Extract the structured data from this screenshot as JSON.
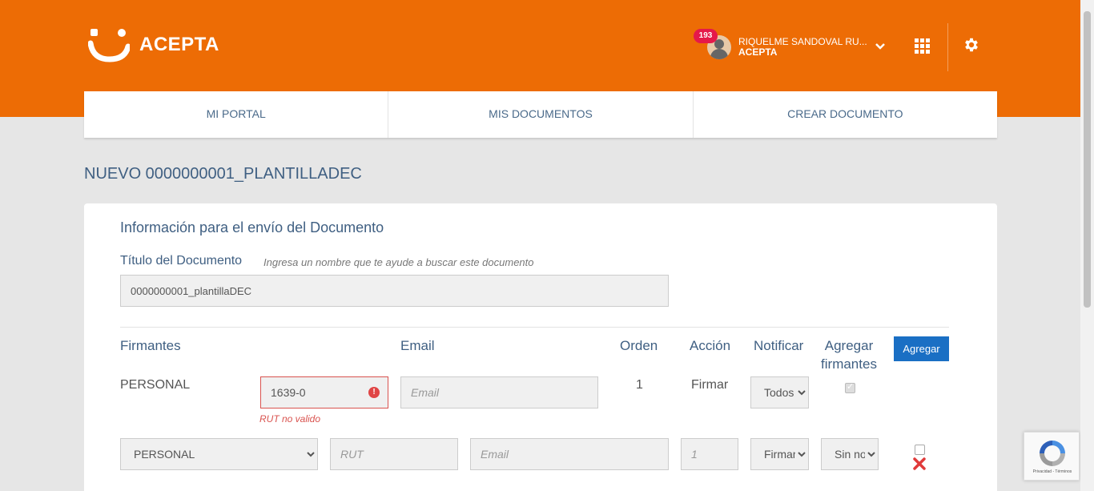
{
  "brand": {
    "name": "ACEPTA",
    "accent": "#ed6c05"
  },
  "user": {
    "notifications": "193",
    "name": "RIQUELME SANDOVAL RU...",
    "company": "ACEPTA"
  },
  "nav": {
    "items": [
      "MI PORTAL",
      "MIS DOCUMENTOS",
      "CREAR DOCUMENTO"
    ]
  },
  "page": {
    "title": "NUEVO 0000000001_PLANTILLADEC"
  },
  "form": {
    "section_title": "Información para el envío del Documento",
    "doc_label": "Título del Documento",
    "doc_hint": "Ingresa un nombre que te ayude a buscar este documento",
    "doc_value": "0000000001_plantillaDEC"
  },
  "signers": {
    "headers": {
      "firmantes": "Firmantes",
      "email": "Email",
      "orden": "Orden",
      "accion": "Acción",
      "notificar": "Notificar",
      "agregar_firmantes_1": "Agregar",
      "agregar_firmantes_2": "firmantes"
    },
    "add_button": "Agregar",
    "row1": {
      "type": "PERSONAL",
      "rut_value": "1639-0",
      "rut_error": "RUT no valido",
      "email_placeholder": "Email",
      "orden": "1",
      "accion": "Firmar",
      "notificar": "Todos"
    },
    "row2": {
      "type": "PERSONAL",
      "rut_placeholder": "RUT",
      "email_placeholder": "Email",
      "orden_placeholder": "1",
      "accion": "Firmar",
      "notificar": "Sin notificar"
    }
  },
  "recaptcha": {
    "text": "Privacidad - Términos"
  }
}
